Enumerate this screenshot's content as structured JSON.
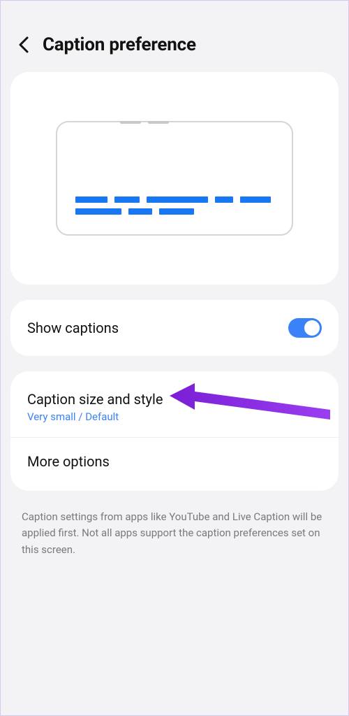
{
  "header": {
    "title": "Caption preference"
  },
  "show_captions": {
    "label": "Show captions",
    "enabled": true
  },
  "caption_style": {
    "title": "Caption size and style",
    "subtitle": "Very small / Default"
  },
  "more_options": {
    "title": "More options"
  },
  "footer": {
    "note": "Caption settings from apps like YouTube and Live Caption will be applied first. Not all apps support the caption preferences set on this screen."
  }
}
